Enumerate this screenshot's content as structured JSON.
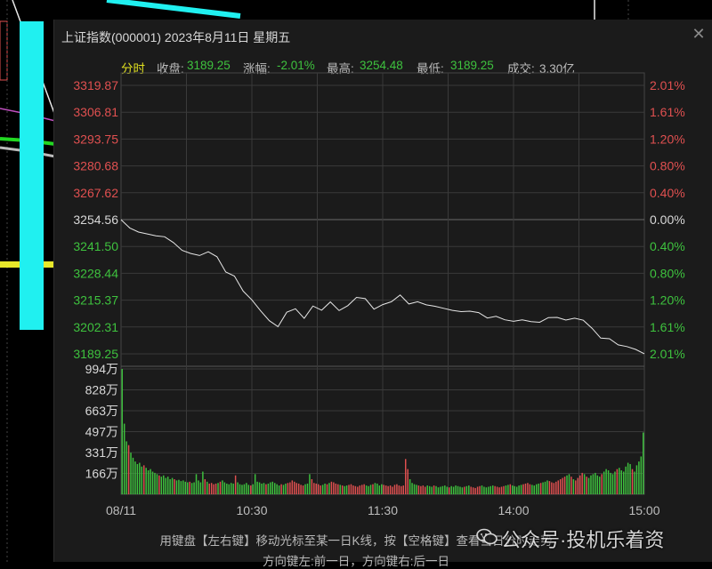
{
  "window": {
    "title": "上证指数(000001) 2023年8月11日 星期五",
    "close_glyph": "✕"
  },
  "info_bar": {
    "mode": "分时",
    "close_label": "收盘:",
    "close_value": "3189.25",
    "change_label": "涨幅:",
    "change_value": "-2.01%",
    "high_label": "最高:",
    "high_value": "3254.48",
    "low_label": "最低:",
    "low_value": "3189.25",
    "turnover_label": "成交:",
    "turnover_value": "3.30亿"
  },
  "footer": {
    "line1": "用键盘【左右键】移动光标至某一日K线，按【空格键】查看当日分时走势",
    "line2": "方向键左:前一日，方向键右:后一日"
  },
  "watermark": {
    "text": "公众号·投机乐着资"
  },
  "colors": {
    "up": "#e05050",
    "down": "#3ec23e",
    "neutral": "#d8d8d8",
    "line": "#e6e6e6",
    "grid": "#3a3a3a",
    "background": "#1b1b1b"
  },
  "chart_data": {
    "type": "line",
    "title": "上证指数(000001) 2023年8月11日 星期五",
    "prev_close": 3254.56,
    "price_axis": {
      "ylim": [
        3189.25,
        3319.87
      ],
      "ticks": [
        "3319.87",
        "3306.81",
        "3293.75",
        "3280.68",
        "3267.62",
        "3254.56",
        "3241.50",
        "3228.44",
        "3215.37",
        "3202.31",
        "3189.25"
      ],
      "pct_ticks": [
        "2.01%",
        "1.61%",
        "1.20%",
        "0.80%",
        "0.40%",
        "0.00%",
        "0.40%",
        "0.80%",
        "1.20%",
        "1.61%",
        "2.01%"
      ]
    },
    "x_ticks": [
      "08/11",
      "10:30",
      "11:30",
      "14:00",
      "15:00"
    ],
    "series": [
      {
        "x": [
          0,
          4,
          8,
          12,
          16,
          20,
          24,
          28,
          32,
          36,
          40,
          44,
          48,
          52,
          56,
          60,
          64,
          68,
          72,
          76,
          80,
          84,
          88,
          92,
          96,
          100,
          104,
          108,
          112,
          116,
          120,
          124,
          128,
          132,
          136,
          140,
          144,
          148,
          152,
          156,
          160,
          164,
          168,
          172,
          176,
          180,
          184,
          188,
          192,
          196,
          200,
          204,
          208,
          212,
          216,
          220,
          224,
          228,
          232,
          236,
          240
        ],
        "values": [
          3254.5,
          3250.5,
          3248.5,
          3247.6,
          3246.7,
          3246.2,
          3243.4,
          3239.6,
          3238.1,
          3237.1,
          3238.9,
          3236.5,
          3229.1,
          3227.1,
          3219.8,
          3215.5,
          3210.2,
          3205.4,
          3202.5,
          3209.5,
          3211.2,
          3206.5,
          3212.5,
          3210.5,
          3214.5,
          3210.3,
          3212.7,
          3216.7,
          3216.1,
          3211.0,
          3213.2,
          3214.6,
          3217.9,
          3213.5,
          3214.6,
          3213.1,
          3212.4,
          3211.4,
          3210.4,
          3209.8,
          3210.0,
          3209.3,
          3206.7,
          3207.5,
          3205.8,
          3205.1,
          3205.8,
          3204.9,
          3204.6,
          3206.9,
          3207.0,
          3205.7,
          3206.6,
          3205.6,
          3201.7,
          3196.9,
          3196.6,
          3193.6,
          3192.8,
          3191.4,
          3189.3
        ]
      }
    ],
    "volume": {
      "unit": "万",
      "ylim": [
        0,
        994
      ],
      "ticks": [
        "994万",
        "828万",
        "663万",
        "497万",
        "331万",
        "166万"
      ],
      "values": [
        994,
        560,
        420,
        390,
        330,
        290,
        260,
        240,
        250,
        220,
        230,
        210,
        190,
        200,
        180,
        170,
        160,
        150,
        140,
        150,
        130,
        140,
        120,
        130,
        120,
        110,
        115,
        105,
        110,
        100,
        95,
        100,
        90,
        95,
        160,
        110,
        95,
        180,
        120,
        100,
        85,
        90,
        80,
        85,
        90,
        100,
        110,
        95,
        85,
        80,
        90,
        85,
        150,
        95,
        80,
        75,
        80,
        90,
        75,
        70,
        80,
        160,
        100,
        95,
        85,
        90,
        80,
        85,
        95,
        100,
        90,
        80,
        70,
        80,
        75,
        85,
        90,
        95,
        110,
        100,
        90,
        85,
        75,
        70,
        80,
        85,
        160,
        120,
        90,
        85,
        80,
        70,
        75,
        85,
        80,
        90,
        100,
        95,
        85,
        80,
        75,
        70,
        65,
        70,
        75,
        80,
        70,
        65,
        60,
        70,
        75,
        80,
        70,
        65,
        75,
        80,
        90,
        85,
        70,
        80,
        75,
        70,
        65,
        70,
        60,
        75,
        80,
        70,
        65,
        70,
        280,
        200,
        120,
        90,
        80,
        75,
        70,
        65,
        70,
        60,
        70,
        65,
        60,
        70,
        65,
        55,
        60,
        65,
        70,
        60,
        55,
        65,
        60,
        70,
        65,
        60,
        55,
        60,
        65,
        70,
        60,
        55,
        50,
        60,
        65,
        70,
        60,
        55,
        60,
        65,
        70,
        65,
        60,
        55,
        60,
        65,
        70,
        75,
        80,
        70,
        65,
        60,
        70,
        75,
        80,
        85,
        90,
        80,
        75,
        70,
        80,
        85,
        90,
        95,
        100,
        110,
        105,
        95,
        90,
        100,
        110,
        120,
        130,
        140,
        150,
        160,
        140,
        120,
        110,
        130,
        150,
        170,
        160,
        140,
        130,
        150,
        160,
        170,
        150,
        140,
        160,
        180,
        200,
        190,
        170,
        160,
        180,
        200,
        210,
        190,
        180,
        220,
        250,
        240,
        200,
        180,
        230,
        260,
        300,
        490
      ]
    }
  }
}
